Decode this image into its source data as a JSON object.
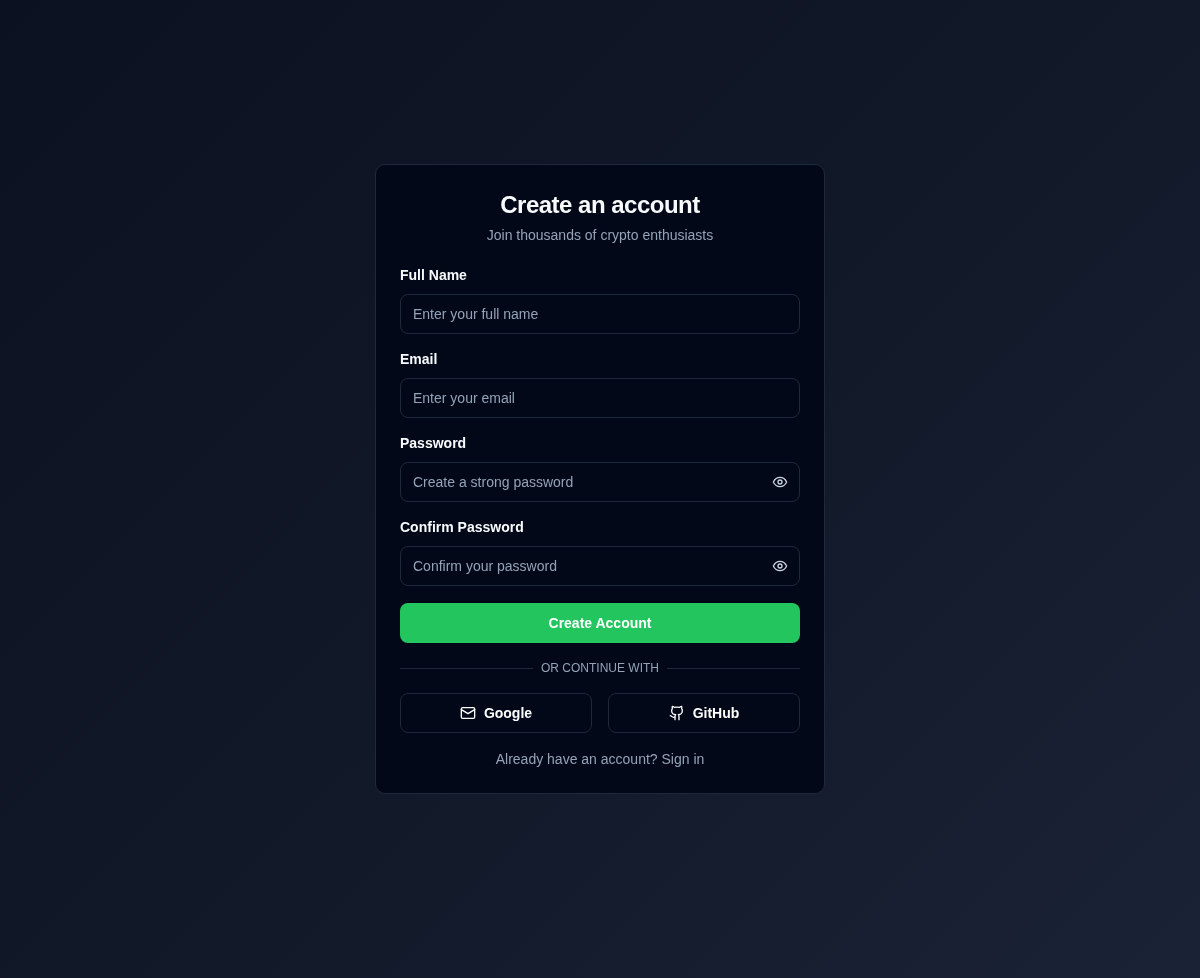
{
  "card": {
    "title": "Create an account",
    "subtitle": "Join thousands of crypto enthusiasts"
  },
  "fields": [
    {
      "label": "Full Name",
      "placeholder": "Enter your full name",
      "kind": "text"
    },
    {
      "label": "Email",
      "placeholder": "Enter your email",
      "kind": "text"
    },
    {
      "label": "Password",
      "placeholder": "Create a strong password",
      "kind": "password"
    },
    {
      "label": "Confirm Password",
      "placeholder": "Confirm your password",
      "kind": "password"
    }
  ],
  "submit": "Create Account",
  "divider": "OR CONTINUE WITH",
  "social": [
    {
      "label": "Google",
      "kind": "mail"
    },
    {
      "label": "GitHub",
      "kind": "github"
    }
  ],
  "footer": {
    "text": "Already have an account?",
    "link": "Sign in"
  }
}
